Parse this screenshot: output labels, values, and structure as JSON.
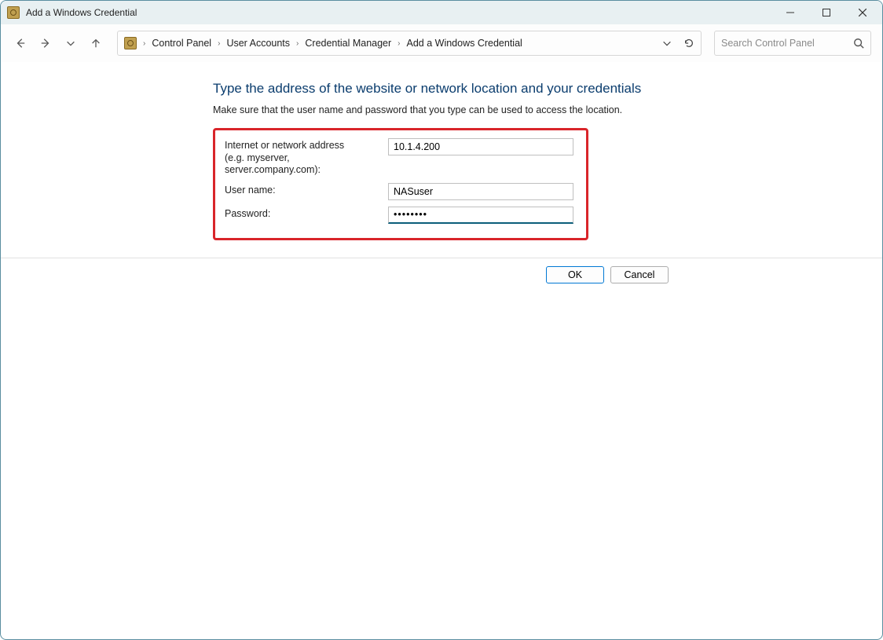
{
  "window": {
    "title": "Add a Windows Credential"
  },
  "breadcrumb": {
    "items": [
      "Control Panel",
      "User Accounts",
      "Credential Manager",
      "Add a Windows Credential"
    ]
  },
  "search": {
    "placeholder": "Search Control Panel"
  },
  "page": {
    "heading": "Type the address of the website or network location and your credentials",
    "subtext": "Make sure that the user name and password that you type can be used to access the location."
  },
  "form": {
    "address_label_l1": "Internet or network address",
    "address_label_l2": "(e.g. myserver, server.company.com):",
    "address_value": "10.1.4.200",
    "username_label": "User name:",
    "username_value": "NASuser",
    "password_label": "Password:",
    "password_value": "••••••••"
  },
  "buttons": {
    "ok": "OK",
    "cancel": "Cancel"
  }
}
